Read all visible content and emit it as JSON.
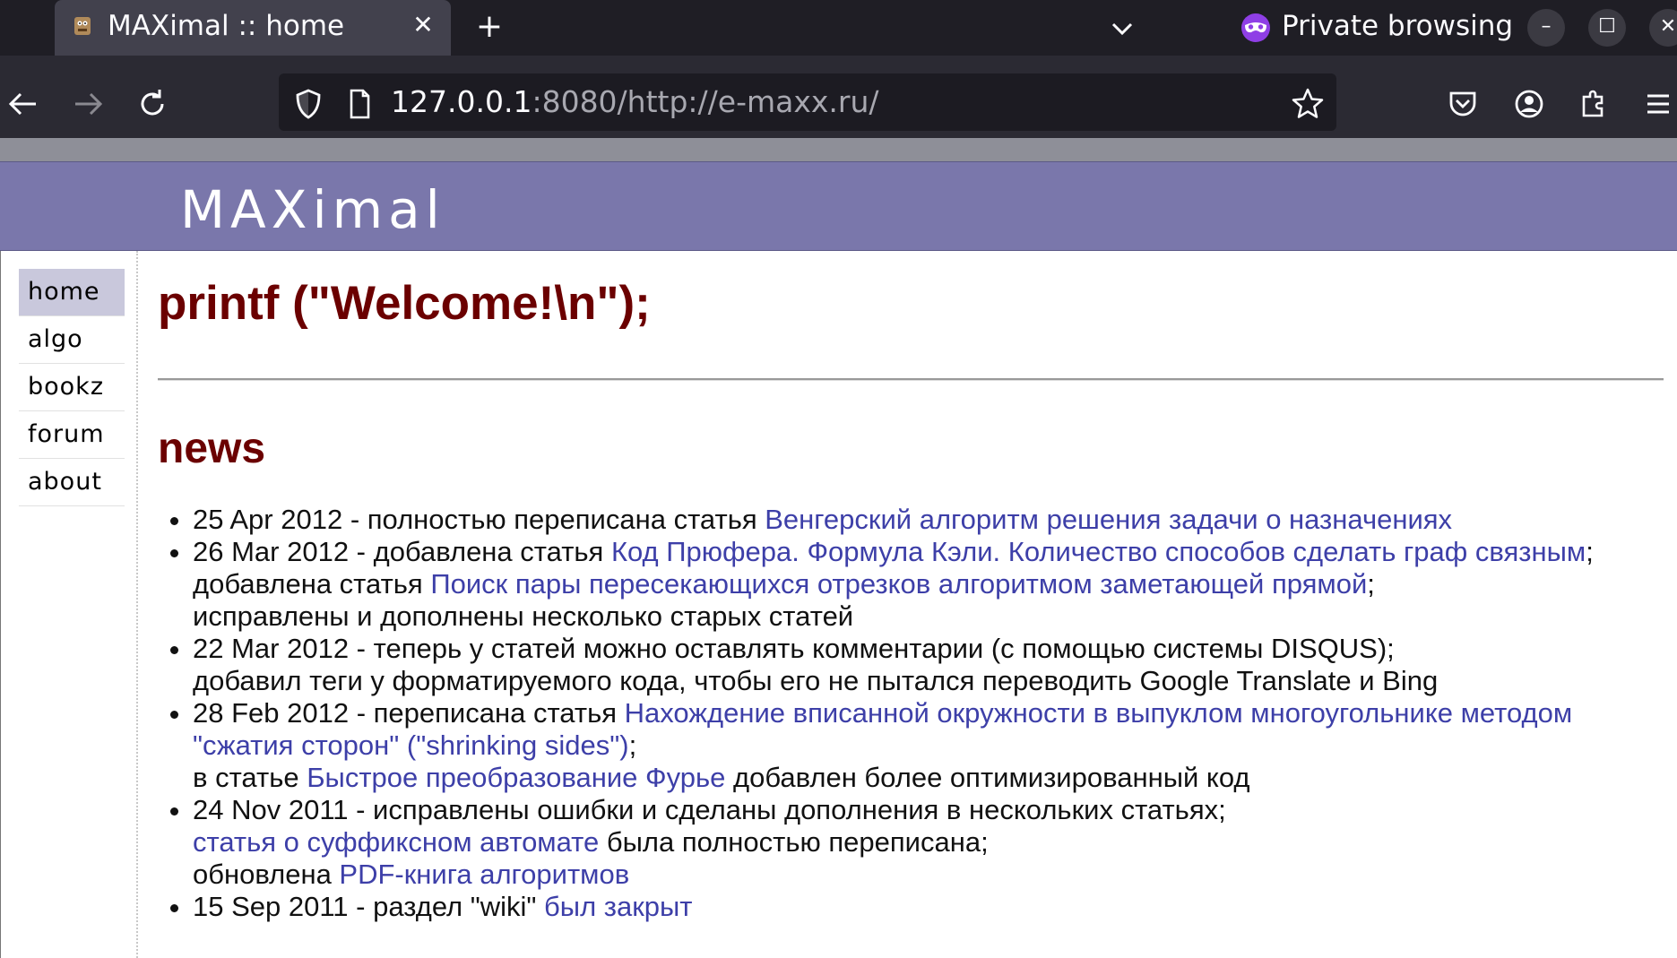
{
  "browser": {
    "tab_title": "MAXimal :: home",
    "private_label": "Private browsing",
    "url_host": "127.0.0.1",
    "url_rest": ":8080/http://e-maxx.ru/"
  },
  "site": {
    "logo": "MAXimal",
    "menu": [
      {
        "label": "home",
        "active": true
      },
      {
        "label": "algo"
      },
      {
        "label": "bookz"
      },
      {
        "label": "forum"
      },
      {
        "label": "about"
      }
    ]
  },
  "main": {
    "welcome": "printf (\"Welcome!\\n\");",
    "news_title": "news",
    "news": [
      {
        "lines": [
          [
            {
              "t": "25 Apr 2012 - полностью переписана статья "
            },
            {
              "link": "Венгерский алгоритм решения задачи о назначениях"
            }
          ]
        ]
      },
      {
        "lines": [
          [
            {
              "t": "26 Mar 2012 - добавлена статья "
            },
            {
              "link": "Код Прюфера. Формула Кэли. Количество способов сделать граф связным"
            },
            {
              "t": ";"
            }
          ],
          [
            {
              "t": "добавлена статья "
            },
            {
              "link": "Поиск пары пересекающихся отрезков алгоритмом заметающей прямой"
            },
            {
              "t": ";"
            }
          ],
          [
            {
              "t": "исправлены и дополнены несколько старых статей"
            }
          ]
        ]
      },
      {
        "lines": [
          [
            {
              "t": "22 Mar 2012 - теперь у статей можно оставлять комментарии (с помощью системы DISQUS);"
            }
          ],
          [
            {
              "t": "добавил теги у форматируемого кода, чтобы его не пытался переводить Google Translate и Bing"
            }
          ]
        ]
      },
      {
        "lines": [
          [
            {
              "t": "28 Feb 2012 - переписана статья "
            },
            {
              "link": "Нахождение вписанной окружности в выпуклом многоугольнике методом \"сжатия сторон\" (\"shrinking sides\")"
            },
            {
              "t": ";"
            }
          ],
          [
            {
              "t": "в статье "
            },
            {
              "link": "Быстрое преобразование Фурье"
            },
            {
              "t": " добавлен более оптимизированный код"
            }
          ]
        ]
      },
      {
        "lines": [
          [
            {
              "t": "24 Nov 2011 - исправлены ошибки и сделаны дополнения в нескольких статьях;"
            }
          ],
          [
            {
              "link": "статья о суффиксном автомате"
            },
            {
              "t": " была полностью переписана;"
            }
          ],
          [
            {
              "t": "обновлена "
            },
            {
              "link": "PDF-книга алгоритмов"
            }
          ]
        ]
      },
      {
        "lines": [
          [
            {
              "t": "15 Sep 2011 - раздел \"wiki\" "
            },
            {
              "link": "был закрыт"
            }
          ]
        ]
      }
    ]
  }
}
